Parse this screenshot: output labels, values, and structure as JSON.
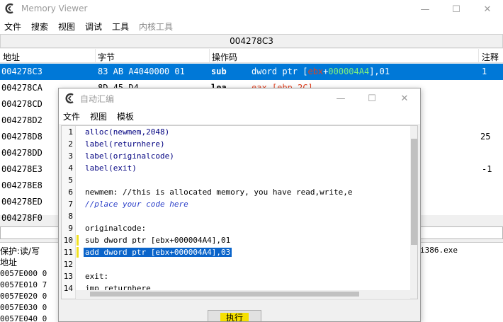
{
  "main_window": {
    "title": "Memory Viewer",
    "controls": {
      "minimize": "—",
      "maximize": "☐",
      "close": "✕"
    },
    "menu": [
      "文件",
      "搜索",
      "视图",
      "调试",
      "工具",
      "内核工具"
    ],
    "address_bar": "004278C3",
    "columns": {
      "address": "地址",
      "bytes": "字节",
      "opcode": "操作码",
      "comment": "注释"
    },
    "rows": [
      {
        "address": "004278C3",
        "bytes": "83 AB A4040000 01",
        "mnemonic": "sub",
        "operand_pre": "dword ptr [",
        "operand_reg": "ebx",
        "operand_plus": "+",
        "operand_num": "000004A4",
        "operand_post": "],01",
        "comment": "1"
      },
      {
        "address": "004278CA",
        "bytes": "8D 45 D4",
        "mnemonic": "lea",
        "operand_pre": "eax,[ebp-2C]",
        "operand_reg": "",
        "operand_plus": "",
        "operand_num": "",
        "operand_post": "",
        "comment": ""
      },
      {
        "address": "004278CD",
        "bytes": "",
        "mnemonic": "",
        "operand_pre": "",
        "operand_reg": "",
        "operand_plus": "",
        "operand_num": "",
        "operand_post": "",
        "comment": ""
      },
      {
        "address": "004278D2",
        "bytes": "",
        "mnemonic": "",
        "operand_pre": "",
        "operand_reg": "",
        "operand_plus": "",
        "operand_num": "",
        "operand_post": "",
        "comment": ""
      },
      {
        "address": "004278D8",
        "bytes": "",
        "mnemonic": "",
        "operand_pre": "",
        "operand_reg": "",
        "operand_plus": "",
        "operand_num": "",
        "operand_post": "",
        "comment": "25"
      },
      {
        "address": "004278DD",
        "bytes": "",
        "mnemonic": "",
        "operand_pre": "",
        "operand_reg": "",
        "operand_plus": "",
        "operand_num": "",
        "operand_post": "",
        "comment": ""
      },
      {
        "address": "004278E3",
        "bytes": "",
        "mnemonic": "",
        "operand_pre": "",
        "operand_reg": "",
        "operand_plus": "",
        "operand_num": "",
        "operand_post": "",
        "comment": "-1"
      },
      {
        "address": "004278E8",
        "bytes": "",
        "mnemonic": "",
        "operand_pre": "",
        "operand_reg": "",
        "operand_plus": "",
        "operand_num": "",
        "operand_post": "",
        "comment": ""
      },
      {
        "address": "004278ED",
        "bytes": "",
        "mnemonic": "",
        "operand_pre": "",
        "operand_reg": "",
        "operand_plus": "",
        "operand_num": "",
        "operand_post": "",
        "comment": ""
      },
      {
        "address": "004278F0",
        "bytes": "",
        "mnemonic": "",
        "operand_pre": "",
        "operand_reg": "",
        "operand_plus": "",
        "operand_num": "",
        "operand_post": "",
        "comment": ""
      }
    ],
    "hex": {
      "protect": "保护:读/写",
      "module": "i386.exe",
      "address_label": "地址",
      "rows": [
        {
          "address": "0057E000",
          "data": "0"
        },
        {
          "address": "0057E010",
          "data": "7"
        },
        {
          "address": "0057E020",
          "data": "0"
        },
        {
          "address": "0057E030",
          "data": "0"
        },
        {
          "address": "0057E040",
          "data": "0"
        }
      ]
    }
  },
  "auto_assemble": {
    "title": "自动汇编",
    "controls": {
      "minimize": "—",
      "maximize": "☐",
      "close": "✕"
    },
    "menu": [
      "文件",
      "视图",
      "模板"
    ],
    "execute_label": "执行",
    "lines": [
      {
        "n": "1",
        "text": "alloc(newmem,2048)"
      },
      {
        "n": "2",
        "text": "label(returnhere)"
      },
      {
        "n": "3",
        "text": "label(originalcode)"
      },
      {
        "n": "4",
        "text": "label(exit)"
      },
      {
        "n": "5",
        "text": ""
      },
      {
        "n": "6",
        "text": "newmem: //this is allocated memory, you have read,write,e"
      },
      {
        "n": "7",
        "text": "//place your code here"
      },
      {
        "n": "8",
        "text": ""
      },
      {
        "n": "9",
        "text": "originalcode:"
      },
      {
        "n": "10",
        "text": "sub dword ptr [ebx+000004A4],01"
      },
      {
        "n": "11",
        "text": "add dword ptr [ebx+000004A4],03"
      },
      {
        "n": "12",
        "text": ""
      },
      {
        "n": "13",
        "text": "exit:"
      },
      {
        "n": "14",
        "text": "jmp returnhere"
      }
    ]
  },
  "colors": {
    "selection": "#0078d7",
    "editor_highlight": "#0a64ca",
    "register": "#d47800",
    "number": "#008000",
    "comment": "#2a3ec8",
    "change_marker": "#f0e020",
    "execute_highlight": "#f5e000"
  },
  "icons": {
    "app": "cheat-engine-logo-icon"
  }
}
